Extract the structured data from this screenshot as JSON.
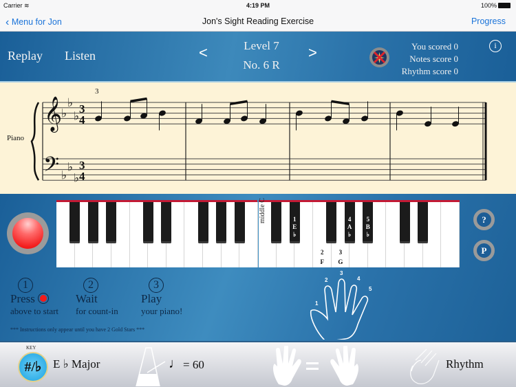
{
  "status_bar": {
    "carrier": "Carrier",
    "wifi_icon": "wifi-icon",
    "time": "4:19 PM",
    "battery": "100%"
  },
  "nav": {
    "back_label": "Menu for Jon",
    "title": "Jon's Sight Reading Exercise",
    "right_label": "Progress"
  },
  "toolbar": {
    "replay_label": "Replay",
    "listen_label": "Listen",
    "prev_label": "<",
    "next_label": ">",
    "level": "Level 7",
    "number": "No. 6 R",
    "you_scored": "You scored 0",
    "notes_score": "Notes score 0",
    "rhythm_score": "Rhythm score 0",
    "info_label": "i"
  },
  "score": {
    "instrument": "Piano",
    "key_signature": "E♭ major (3 flats)",
    "time_signature": {
      "top": "3",
      "bottom": "4"
    },
    "fingering_mark": "3",
    "measures": [
      [
        "G4 quarter",
        "G4 eighth",
        "A♭4 eighth",
        "B♭4 quarter"
      ],
      [
        "F4 quarter",
        "F4 eighth",
        "G4 eighth",
        "F4 quarter"
      ],
      [
        "B♭4 quarter",
        "G4 eighth",
        "F4 eighth",
        "G4 quarter"
      ],
      [
        "B♭4 quarter",
        "E♭4 quarter",
        "E♭4 quarter"
      ]
    ]
  },
  "keyboard": {
    "middle_c_label": "middle C",
    "black_key_labels": [
      {
        "finger": "1",
        "note": "E",
        "acc": "♭"
      },
      {
        "finger": "4",
        "note": "A",
        "acc": "♭"
      },
      {
        "finger": "5",
        "note": "B",
        "acc": "♭"
      }
    ],
    "white_key_labels": [
      {
        "finger": "2",
        "note": "F"
      },
      {
        "finger": "3",
        "note": "G"
      }
    ],
    "help_button": "?",
    "p_button": "P"
  },
  "instructions": {
    "steps": [
      {
        "num": "1",
        "head": "Press",
        "sub": "above to start"
      },
      {
        "num": "2",
        "head": "Wait",
        "sub": "for count-in"
      },
      {
        "num": "3",
        "head": "Play",
        "sub": "your piano!"
      }
    ],
    "note": "*** Instructions only appear until you have 2 Gold Stars ***"
  },
  "hand_fingers": [
    "1",
    "2",
    "3",
    "4",
    "5"
  ],
  "bottom": {
    "key_badge": "KEY",
    "key_symbol": "#/♭",
    "key_label": "E ♭  Major",
    "tempo_note": "♩",
    "tempo_value": "=  60",
    "hands_equal": "=",
    "rhythm_label": "Rhythm"
  },
  "colors": {
    "accent_blue": "#1a73d9",
    "panel_blue": "#1d6198",
    "record_red": "#f21b1b",
    "keyboard_red": "#c41a34",
    "paper": "#fdf3d7"
  }
}
